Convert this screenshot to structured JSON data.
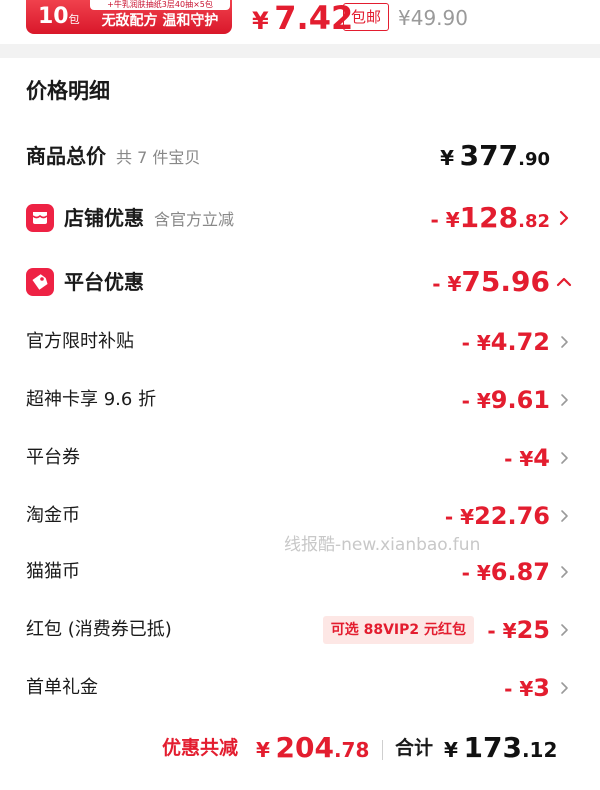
{
  "product_strip": {
    "promo_fine": "+牛乳润肤抽纸3层40抽×5包",
    "promo_count": "10",
    "promo_count_unit": "包",
    "promo_text": "无敌配方 温和守护",
    "unit_price_currency": "¥",
    "unit_price": "7.42",
    "free_shipping": "包邮",
    "original_price": "¥49.90"
  },
  "detail": {
    "title": "价格明细",
    "total": {
      "label": "商品总价",
      "sub": "共 7 件宝贝",
      "currency": "¥",
      "int": "377",
      "dec": ".90"
    },
    "shop": {
      "label": "店铺优惠",
      "sub": "含官方立减",
      "prefix": "- ¥",
      "int": "128",
      "dec": ".82"
    },
    "platform": {
      "label": "平台优惠",
      "prefix": "- ¥",
      "amount": "75.96"
    },
    "items": [
      {
        "label": "官方限时补贴",
        "prefix": "- ¥",
        "amount": "4.72"
      },
      {
        "label": "超神卡享 9.6 折",
        "prefix": "- ¥",
        "amount": "9.61"
      },
      {
        "label": "平台券",
        "prefix": "- ¥",
        "amount": "4"
      },
      {
        "label": "淘金币",
        "prefix": "- ¥",
        "amount": "22.76"
      },
      {
        "label": "猫猫币",
        "prefix": "- ¥",
        "amount": "6.87"
      },
      {
        "label": "红包 (消费券已抵)",
        "prefix": "- ¥",
        "amount": "25",
        "tag": "可选 88VIP2 元红包"
      },
      {
        "label": "首单礼金",
        "prefix": "- ¥",
        "amount": "3"
      }
    ],
    "watermark": "线报酷-new.xianbao.fun"
  },
  "summary": {
    "discount_label": "优惠共减",
    "discount_currency": "¥",
    "discount_int": "204",
    "discount_dec": ".78",
    "total_label": "合计",
    "total_currency": "¥",
    "total_int": "173",
    "total_dec": ".12"
  },
  "colors": {
    "accent": "#e31d2f",
    "icon_bg": "#ee2244",
    "muted": "#888888"
  },
  "icons": [
    "shop-icon",
    "coupon-tag-icon",
    "chevron-right-icon",
    "chevron-up-icon"
  ]
}
